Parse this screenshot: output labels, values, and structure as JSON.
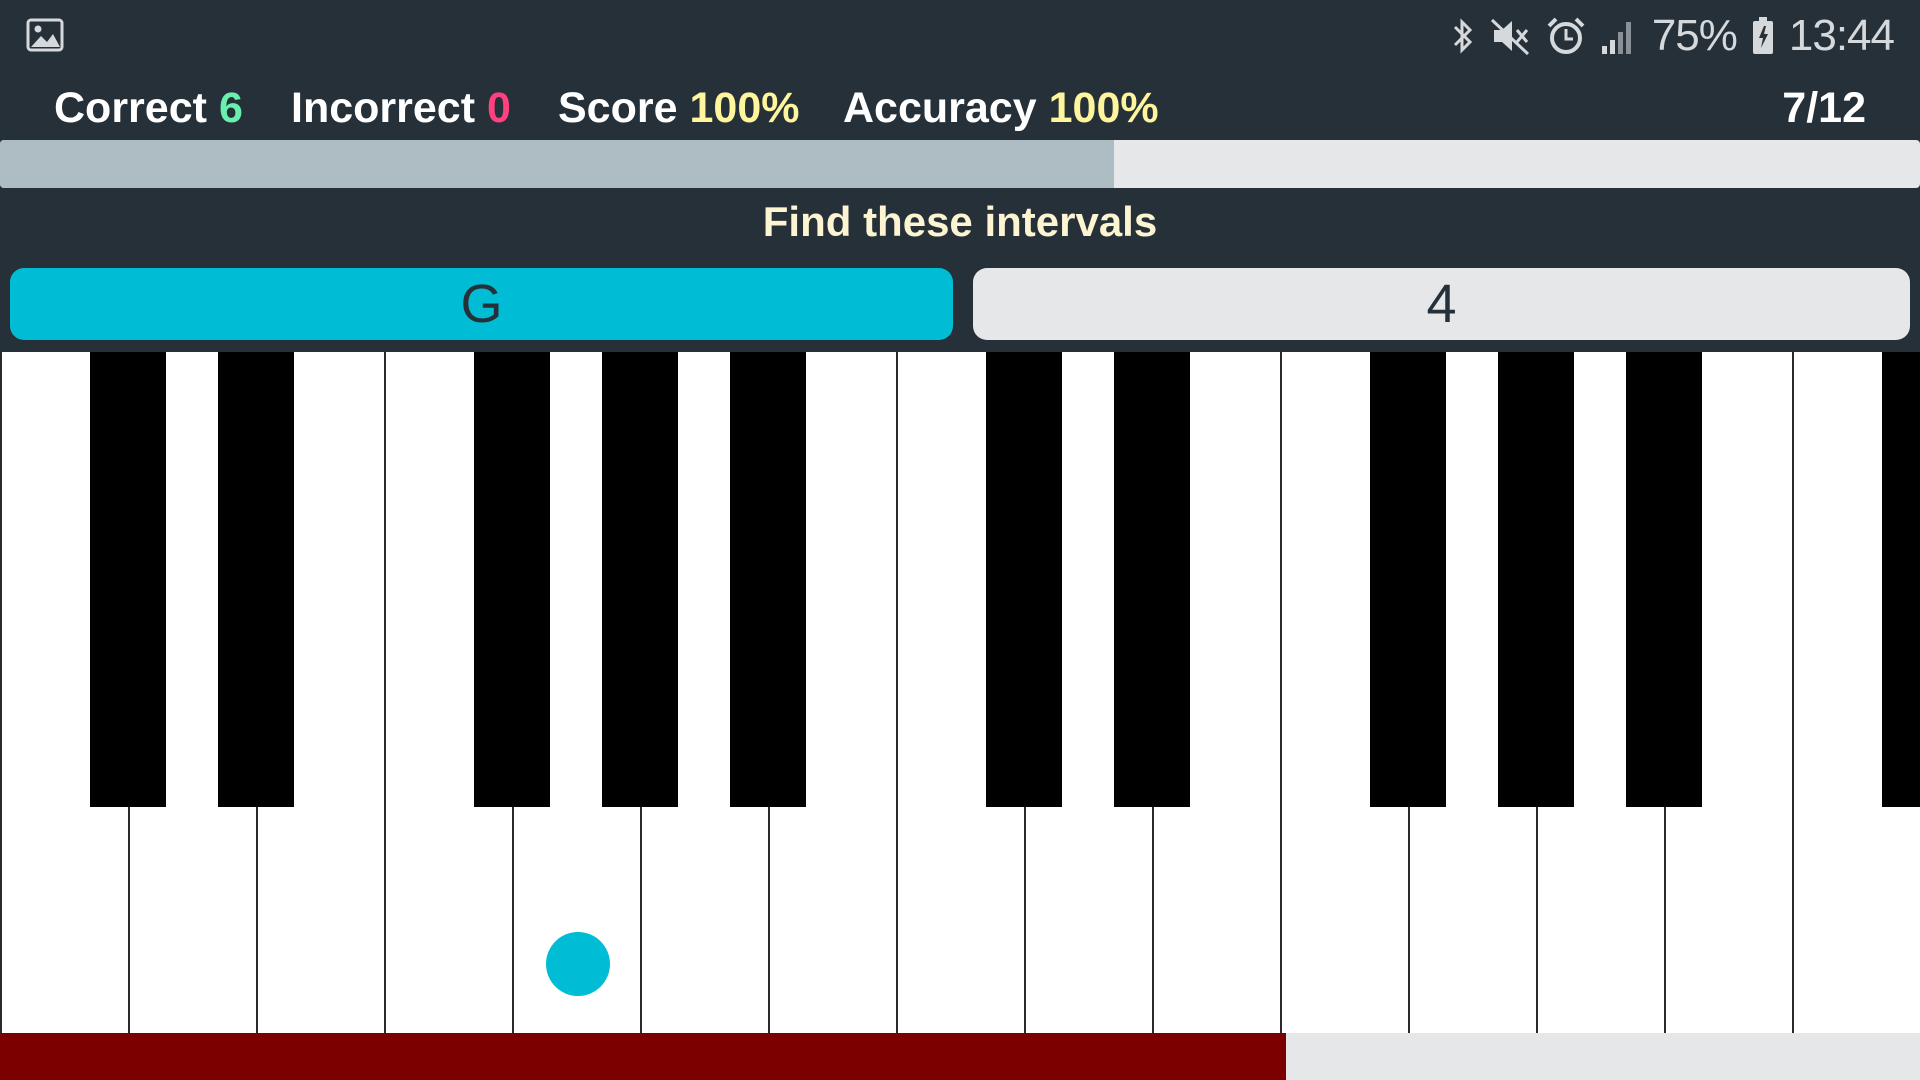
{
  "status_bar": {
    "battery": "75%",
    "time": "13:44",
    "icons": [
      "gallery-icon",
      "bluetooth-icon",
      "mute-icon",
      "alarm-icon",
      "signal-icon",
      "battery-icon"
    ]
  },
  "stats": {
    "correct_label": "Correct",
    "correct_value": "6",
    "incorrect_label": "Incorrect",
    "incorrect_value": "0",
    "score_label": "Score",
    "score_value": "100%",
    "accuracy_label": "Accuracy",
    "accuracy_value": "100%",
    "counter": "7/12"
  },
  "progress": {
    "current": 7,
    "total": 12,
    "fraction": 0.58
  },
  "instruction": "Find these intervals",
  "question": {
    "note": "G",
    "interval": "4"
  },
  "keyboard": {
    "white_key_count": 15,
    "highlighted_white_key_index": 4
  },
  "timer": {
    "fraction": 0.67
  },
  "colors": {
    "background": "#263038",
    "correct": "#69f0ae",
    "incorrect": "#ff4081",
    "score_value": "#fff59d",
    "instruction": "#fdf5d2",
    "accent": "#00bcd4",
    "progress_fill": "#aebcc3",
    "timer_fill": "#7d0000"
  }
}
